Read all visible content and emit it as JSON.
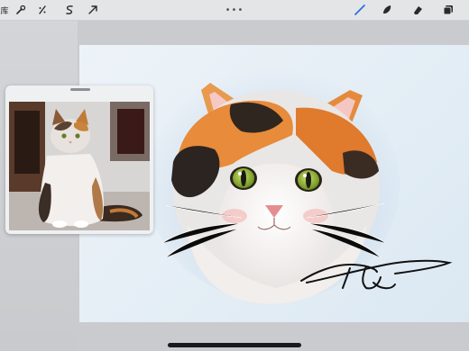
{
  "toolbar": {
    "gallery_label": "库",
    "left_icons": [
      "wrench-icon",
      "adjustments-icon",
      "selection-icon",
      "transform-arrow-icon"
    ],
    "more_label": "•••",
    "right_icons": [
      "brush-icon",
      "smudge-icon",
      "eraser-icon",
      "layers-icon"
    ],
    "active_tool_color": "#2f6fe0"
  },
  "reference": {
    "subject": "calico-cat-photo"
  },
  "canvas": {
    "subject": "calico-cat-painting",
    "background": "#e8f0f6"
  },
  "signature": {
    "style": "handwritten",
    "color": "#111111"
  }
}
